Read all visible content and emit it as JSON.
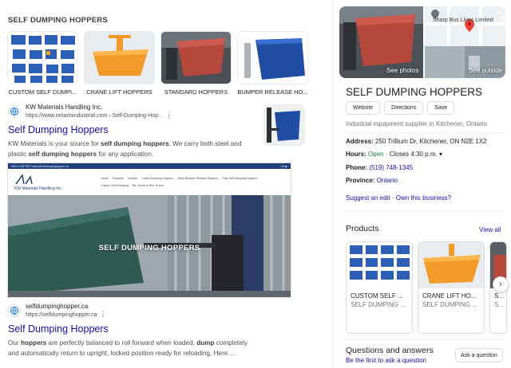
{
  "images_section": {
    "heading": "SELF DUMPING HOPPERS",
    "thumbnails": [
      {
        "caption": "CUSTOM SELF DUMPI..."
      },
      {
        "caption": "CRANE LIFT HOPPERS"
      },
      {
        "caption": "STANDARD HOPPERS"
      },
      {
        "caption": "BUMPER RELEASE HO..."
      }
    ]
  },
  "result1": {
    "site_name": "KW Materials Handling Inc.",
    "url": "https://www.ontarioindustrial.com › Self-Dumping-Hop...",
    "title": "Self Dumping Hoppers",
    "snippet_parts": [
      "KW Materials is your source for ",
      "self dumping hoppers",
      ". We carry both steel and plastic ",
      "self dumping hoppers",
      " for any application."
    ]
  },
  "website_preview": {
    "topbar_left": "855-5-HOPPER  sales@selfdumpinghopper.ca",
    "topbar_right": "f  in  ▶",
    "logo": "KW Materials Handling Inc.",
    "nav_links": [
      "Home",
      "Products",
      "Contact",
      "Crane Dumping Hoppers",
      "Value Bumper Release Hoppers",
      "Poly Self Dumping Hoppers",
      "Custom Self Dumping",
      "Bin Trucks & Box Trucks"
    ],
    "hero_title": "SELF DUMPING HOPPERS"
  },
  "result2": {
    "site_name": "selfdumpinghopper.ca",
    "url": "https://selfdumpinghopper.ca",
    "title": "Self Dumping Hoppers",
    "snippet_parts": [
      "Our ",
      "hoppers",
      " are perfectly balanced to roll forward when loaded, ",
      "dump",
      " completely and automatically return to upright, locked position ready for reloading. Here ..."
    ]
  },
  "knowledge_panel": {
    "see_photos": "See photos",
    "see_outside": "See outside",
    "map_label": "Sharp Bus Lines Limited",
    "title": "SELF DUMPING HOPPERS",
    "buttons": [
      "Website",
      "Directions",
      "Save"
    ],
    "type": "Industrial equipment supplier in Kitchener, Ontario",
    "address_label": "Address:",
    "address": "250 Trillium Dr, Kitchener, ON N2E 1X2",
    "hours_label": "Hours:",
    "hours_status": "Open",
    "hours_close": "· Closes 4:30 p.m.",
    "hours_chevron": "▾",
    "phone_label": "Phone:",
    "phone": "(519) 748-1345",
    "province_label": "Province:",
    "province": "Ontario",
    "suggest_edit": "Suggest an edit",
    "separator": "·",
    "own_business": "Own this business?",
    "products_heading": "Products",
    "view_all": "View all",
    "products": [
      {
        "title": "CUSTOM SELF ...",
        "merchant": "SELF DUMPING ..."
      },
      {
        "title": "CRANE LIFT HO...",
        "merchant": "SELF DUMPING ..."
      },
      {
        "title": "STAN...",
        "merchant": "SELF..."
      }
    ],
    "qa_heading": "Questions and answers",
    "qa_link": "Be the first to ask a question",
    "ask_button": "Ask a question"
  },
  "colors": {
    "link": "#1a0dab",
    "open_green": "#188038",
    "hopper_blue": "#2b5fb8",
    "hopper_orange": "#f29b2a",
    "hopper_red": "#b5483c"
  }
}
